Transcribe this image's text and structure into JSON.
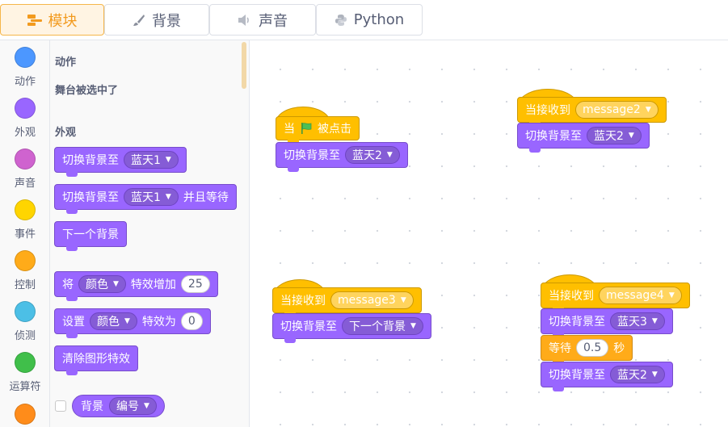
{
  "tabs": [
    {
      "label": "模块",
      "icon": "code-blocks-icon",
      "active": true
    },
    {
      "label": "背景",
      "icon": "brush-icon",
      "active": false
    },
    {
      "label": "声音",
      "icon": "speaker-icon",
      "active": false
    },
    {
      "label": "Python",
      "icon": "python-icon",
      "active": false
    }
  ],
  "categories": [
    {
      "label": "动作",
      "color": "#4c97ff"
    },
    {
      "label": "外观",
      "color": "#9966ff"
    },
    {
      "label": "声音",
      "color": "#cf63cf"
    },
    {
      "label": "事件",
      "color": "#ffd500"
    },
    {
      "label": "控制",
      "color": "#ffab19"
    },
    {
      "label": "侦测",
      "color": "#4cbfe6"
    },
    {
      "label": "运算符",
      "color": "#40bf4a"
    },
    {
      "label": "",
      "color": "#ff8c1a"
    }
  ],
  "palette": {
    "section_motion": "动作",
    "stage_selected": "舞台被选中了",
    "section_looks": "外观",
    "switch_backdrop": {
      "text": "切换背景至",
      "value": "蓝天1"
    },
    "switch_backdrop_wait": {
      "text": "切换背景至",
      "value": "蓝天1",
      "suffix": "并且等待"
    },
    "next_backdrop": "下一个背景",
    "change_effect": {
      "prefix": "将",
      "effect": "颜色",
      "mid": "特效增加",
      "value": "25"
    },
    "set_effect": {
      "prefix": "设置",
      "effect": "颜色",
      "mid": "特效为",
      "value": "0"
    },
    "clear_effects": "清除图形特效",
    "backdrop_reporter": {
      "text": "背景",
      "value": "编号"
    }
  },
  "scripts": {
    "s1": {
      "hat_prefix": "当",
      "hat_suffix": "被点击",
      "cmd": "切换背景至",
      "value": "蓝天2"
    },
    "s2": {
      "hat": "当接收到",
      "message": "message2",
      "cmd": "切换背景至",
      "value": "蓝天2"
    },
    "s3": {
      "hat": "当接收到",
      "message": "message3",
      "cmd": "切换背景至",
      "value": "下一个背景"
    },
    "s4": {
      "hat": "当接收到",
      "message": "message4",
      "cmd1": "切换背景至",
      "value1": "蓝天3",
      "wait_prefix": "等待",
      "wait_value": "0.5",
      "wait_suffix": "秒",
      "cmd2": "切换背景至",
      "value2": "蓝天2"
    }
  }
}
